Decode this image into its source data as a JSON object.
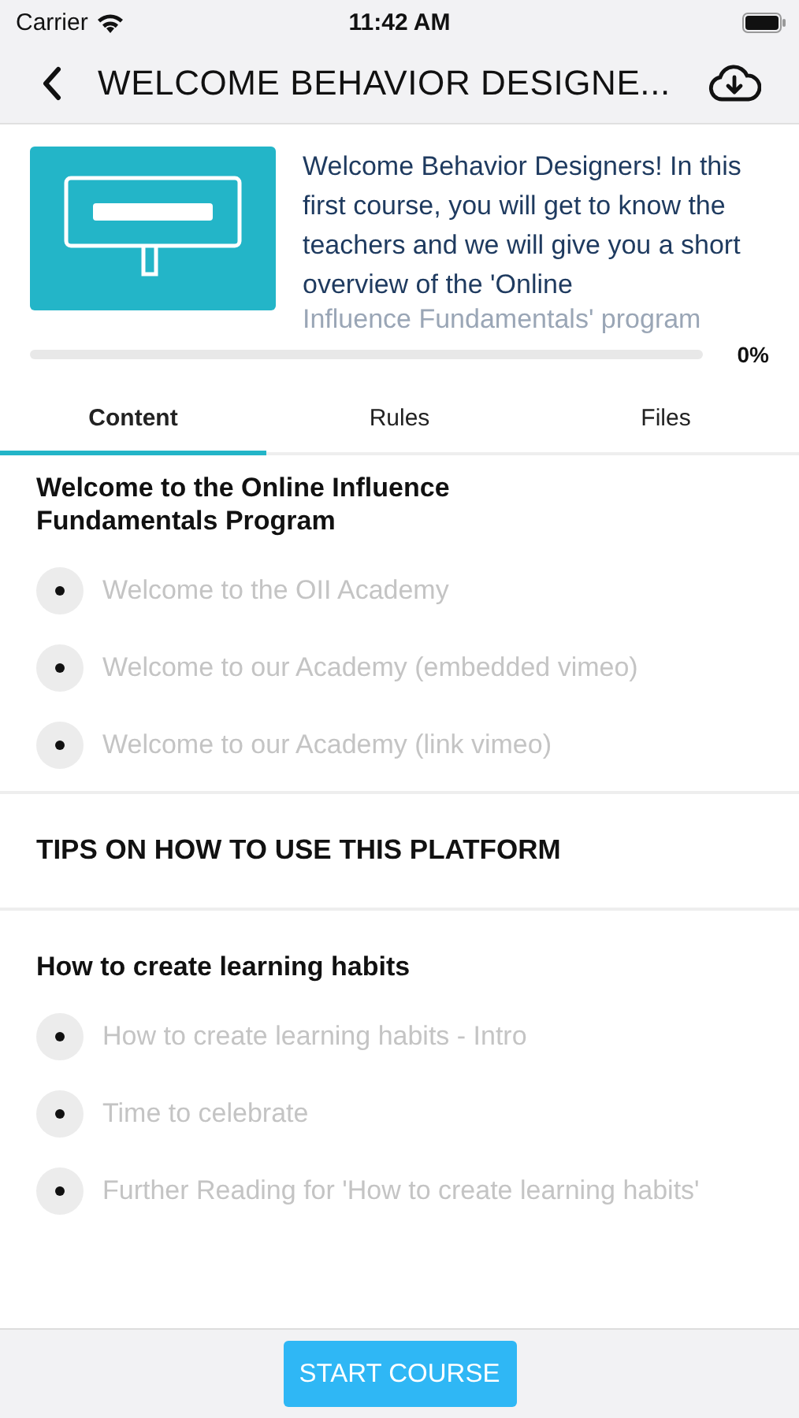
{
  "status_bar": {
    "carrier": "Carrier",
    "time": "11:42 AM"
  },
  "nav": {
    "title": "WELCOME BEHAVIOR DESIGNE..."
  },
  "course": {
    "description": "Welcome Behavior Designers! In this first course, you will get to know the teachers and we will give you a short overview of the 'Online",
    "description_faded": "Influence Fundamentals' program",
    "level": 0,
    "progress_label": "0%"
  },
  "tabs": [
    {
      "label": "Content",
      "selected": true
    },
    {
      "label": "Rules",
      "selected": false
    },
    {
      "label": "Files",
      "selected": false
    }
  ],
  "sections": [
    {
      "title": "Welcome to the Online Influence Fundamentals Program",
      "lessons": [
        {
          "title": "Welcome to the OII Academy",
          "disabled": true
        },
        {
          "title": "Welcome to our Academy (embedded vimeo)",
          "disabled": true
        },
        {
          "title": "Welcome to our Academy (link vimeo)",
          "disabled": true
        }
      ]
    },
    {
      "title": "TIPS ON HOW TO USE THIS PLATFORM"
    },
    {
      "title": "How to create learning habits",
      "lessons": [
        {
          "title": "How to create learning habits - Intro",
          "disabled": true
        },
        {
          "title": "Time to celebrate",
          "disabled": true
        },
        {
          "title": "Further Reading for 'How to create learning habits'",
          "disabled": true
        }
      ]
    }
  ],
  "footer": {
    "button": "START COURSE"
  }
}
